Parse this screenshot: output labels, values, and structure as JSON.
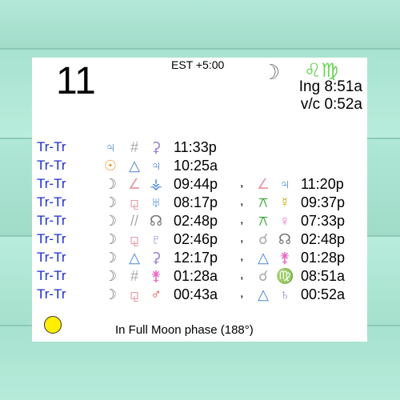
{
  "header": {
    "day": "11",
    "timezone": "EST +5:00",
    "moon_glyph": "☽",
    "sign_glyphs": "♌♍",
    "ingress": "Ing 8:51a",
    "void_of_course": "v/c 0:52a"
  },
  "colors": {
    "label": "#1a2fd0",
    "jupiter": "#4a88d8",
    "sun": "#e89a2a",
    "moon": "#777777",
    "green": "#2ca02c"
  },
  "rows": [
    {
      "label": "Tr-Tr",
      "p1": "♃",
      "p1c": "#4a88d8",
      "asp": "#",
      "aspc": "#aaaaaa",
      "p2": "⚳",
      "p2c": "#9a7fd6",
      "time": "11:33p"
    },
    {
      "label": "Tr-Tr",
      "p1": "☉",
      "p1c": "#e89a2a",
      "asp": "△",
      "aspc": "#4a88d8",
      "p2": "♃",
      "p2c": "#4a88d8",
      "time": "10:25a"
    },
    {
      "label": "Tr-Tr",
      "p1": "☽",
      "p1c": "#777777",
      "asp": "∠",
      "aspc": "#e89aa8",
      "p2": "⚶",
      "p2c": "#4a88d8",
      "time": "09:44p",
      "comma": ",",
      "asp2": "∠",
      "asp2c": "#e89aa8",
      "p3": "♃",
      "p3c": "#4a88d8",
      "time2": "11:20p"
    },
    {
      "label": "Tr-Tr",
      "p1": "☽",
      "p1c": "#777777",
      "asp": "⚼",
      "aspc": "#e89aa8",
      "p2": "♅",
      "p2c": "#4a88d8",
      "time": "08:17p",
      "comma": ",",
      "asp2": "⚻",
      "asp2c": "#2ca02c",
      "p3": "☿",
      "p3c": "#c9a400",
      "time2": "09:37p"
    },
    {
      "label": "Tr-Tr",
      "p1": "☽",
      "p1c": "#777777",
      "asp": "//",
      "aspc": "#aaaaaa",
      "p2": "☊",
      "p2c": "#777777",
      "time": "02:48p",
      "comma": ",",
      "asp2": "⚻",
      "asp2c": "#2ca02c",
      "p3": "♀",
      "p3c": "#e86ac8",
      "time2": "07:33p"
    },
    {
      "label": "Tr-Tr",
      "p1": "☽",
      "p1c": "#777777",
      "asp": "⚼",
      "aspc": "#e89aa8",
      "p2": "♇",
      "p2c": "#9a7fd6",
      "time": "02:46p",
      "comma": ",",
      "asp2": "☌",
      "asp2c": "#aaaaaa",
      "p3": "☊",
      "p3c": "#777777",
      "time2": "02:48p"
    },
    {
      "label": "Tr-Tr",
      "p1": "☽",
      "p1c": "#777777",
      "asp": "△",
      "aspc": "#4a88d8",
      "p2": "⚳",
      "p2c": "#9a7fd6",
      "time": "12:17p",
      "comma": ",",
      "asp2": "△",
      "asp2c": "#4a88d8",
      "p3": "⚵",
      "p3c": "#e86ac8",
      "time2": "01:28p"
    },
    {
      "label": "Tr-Tr",
      "p1": "☽",
      "p1c": "#777777",
      "asp": "#",
      "aspc": "#aaaaaa",
      "p2": "⚵",
      "p2c": "#e86ac8",
      "time": "01:28a",
      "comma": ",",
      "asp2": "☌",
      "asp2c": "#aaaaaa",
      "p3": "♍",
      "p3c": "#6bd35a",
      "time2": "08:51a"
    },
    {
      "label": "Tr-Tr",
      "p1": "☽",
      "p1c": "#777777",
      "asp": "⚼",
      "aspc": "#e89aa8",
      "p2": "♂",
      "p2c": "#e0413a",
      "time": "00:43a",
      "comma": ",",
      "asp2": "△",
      "asp2c": "#4a88d8",
      "p3": "♄",
      "p3c": "#9a7fd6",
      "time2": "00:52a"
    }
  ],
  "footer": {
    "phase_text": "In Full Moon phase (188°)"
  }
}
